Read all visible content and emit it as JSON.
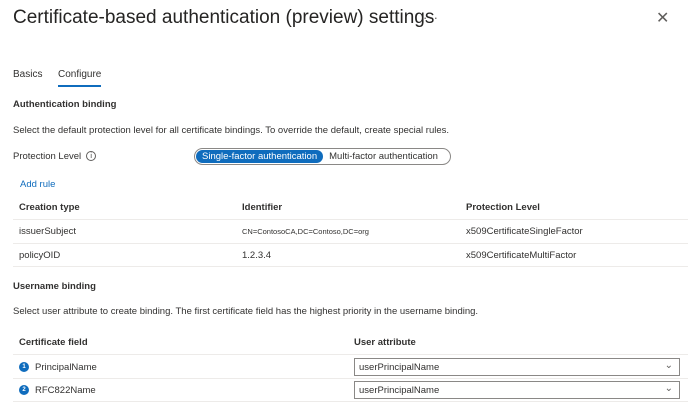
{
  "header": {
    "title": "Certificate-based authentication (preview) settings",
    "more": "···",
    "close": "✕"
  },
  "tabs": [
    {
      "label": "Basics"
    },
    {
      "label": "Configure"
    }
  ],
  "auth_binding": {
    "heading": "Authentication binding",
    "description": "Select the default protection level for all certificate bindings. To override the default, create special rules.",
    "protection_label": "Protection Level",
    "info": "i",
    "options": [
      "Single-factor authentication",
      "Multi-factor authentication"
    ],
    "add_rule": "Add rule",
    "columns": [
      "Creation type",
      "Identifier",
      "Protection Level"
    ],
    "rows": [
      {
        "type": "issuerSubject",
        "identifier": "CN=ContosoCA,DC=Contoso,DC=org",
        "level": "x509CertificateSingleFactor"
      },
      {
        "type": "policyOID",
        "identifier": "1.2.3.4",
        "level": "x509CertificateMultiFactor"
      }
    ]
  },
  "username_binding": {
    "heading": "Username binding",
    "description": "Select user attribute to create binding. The first certificate field has the highest priority in the username binding.",
    "columns": [
      "Certificate field",
      "User attribute"
    ],
    "rows": [
      {
        "n": "1",
        "field": "PrincipalName",
        "attribute": "userPrincipalName"
      },
      {
        "n": "2",
        "field": "RFC822Name",
        "attribute": "userPrincipalName"
      }
    ]
  },
  "colors": {
    "accent": "#0f6cbd"
  }
}
